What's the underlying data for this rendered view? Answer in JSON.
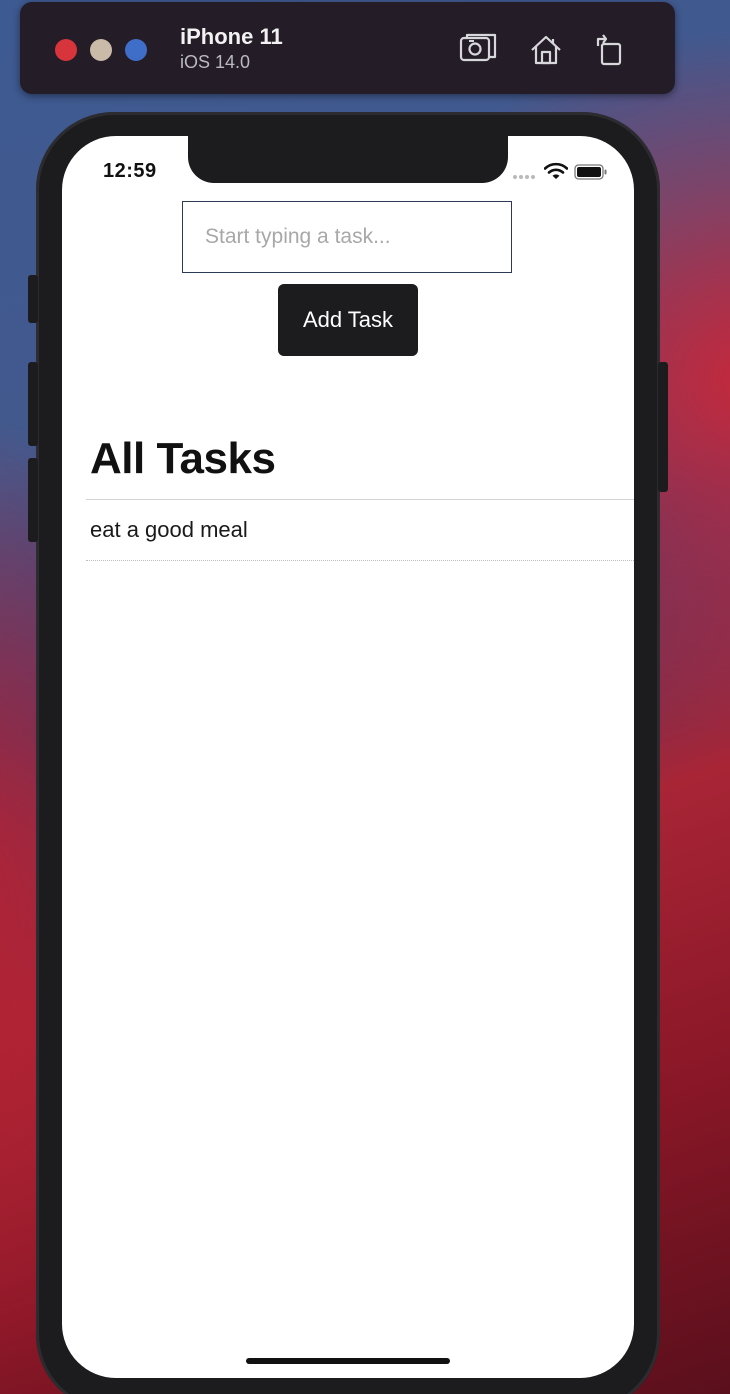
{
  "simulator": {
    "device_name": "iPhone 11",
    "os_version": "iOS 14.0",
    "window_controls": {
      "close_color": "#d8343b",
      "minimize_color": "#c9bba8",
      "zoom_color": "#3f6ec9"
    },
    "toolbar_icons": [
      "screenshot-icon",
      "home-icon",
      "rotate-icon"
    ]
  },
  "status_bar": {
    "time": "12:59",
    "icons": [
      "cellular-signal-icon",
      "wifi-icon",
      "battery-icon"
    ]
  },
  "form": {
    "input_value": "",
    "input_placeholder": "Start typing a task...",
    "add_button_label": "Add Task"
  },
  "tasks_section": {
    "title": "All Tasks",
    "items": [
      {
        "label": "eat a good meal"
      }
    ]
  },
  "colors": {
    "button_bg": "#1c1c1e",
    "button_text": "#ffffff",
    "input_border": "#2d3a56",
    "screen_bg": "#ffffff"
  }
}
